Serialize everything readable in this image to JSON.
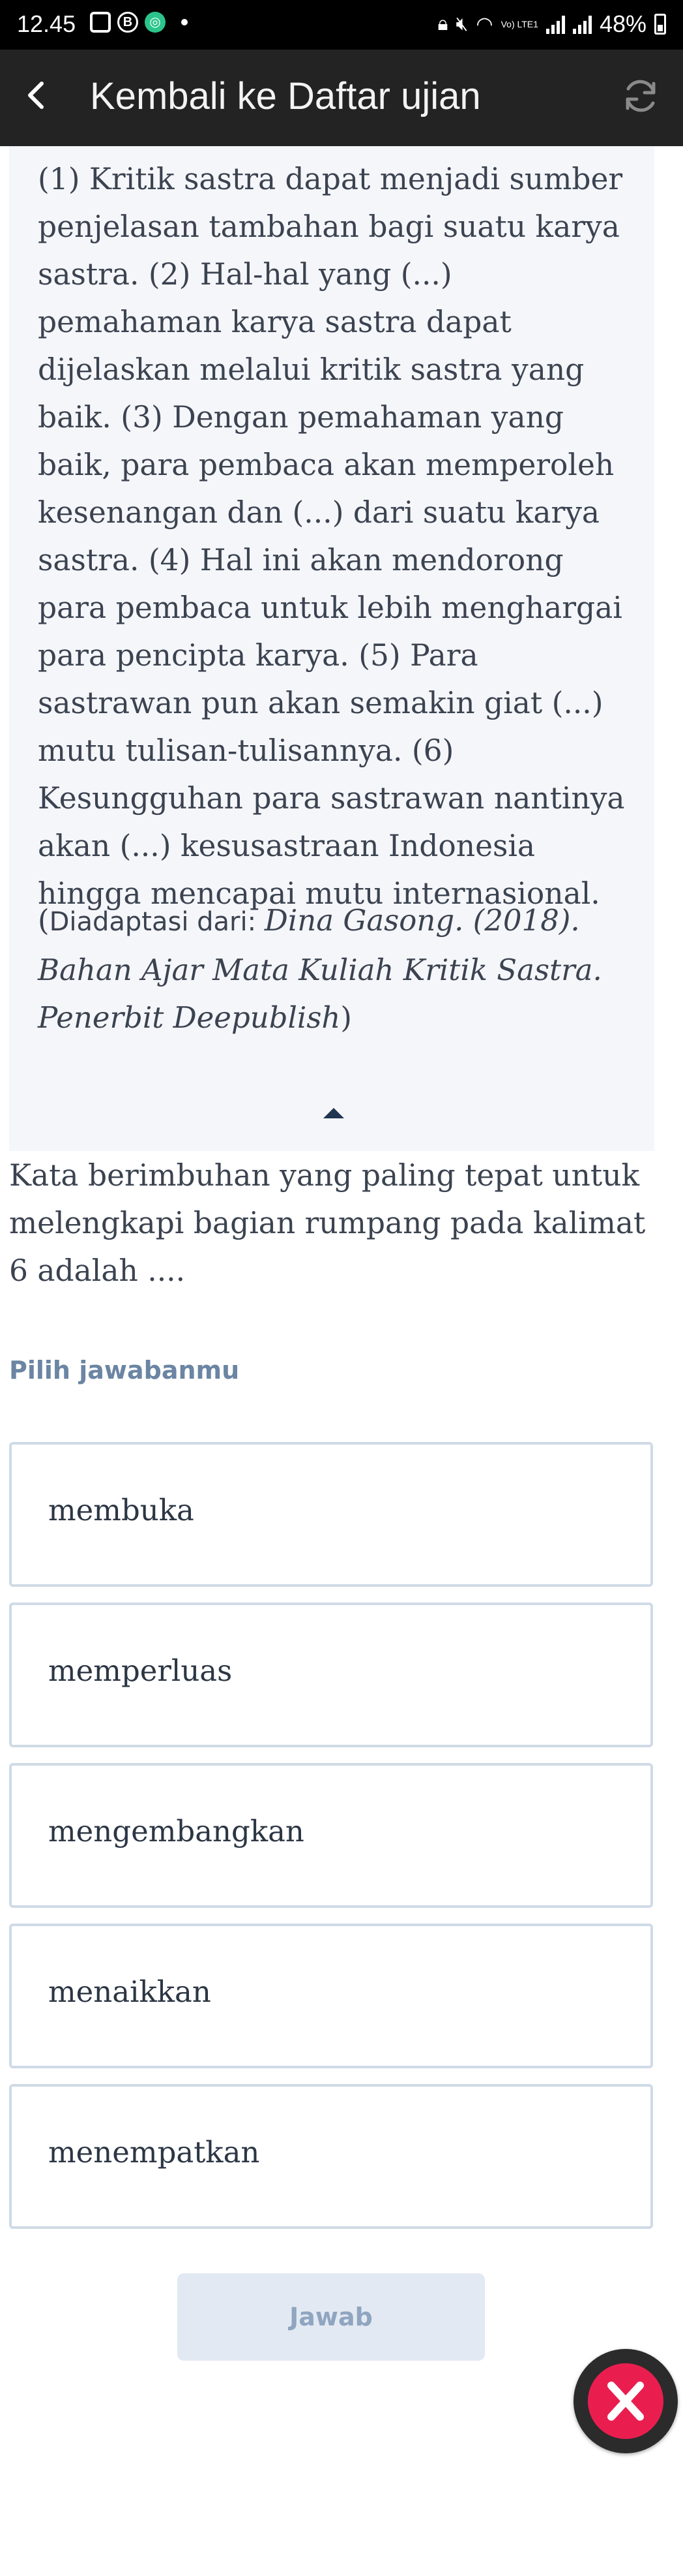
{
  "status_bar": {
    "time": "12.45",
    "network_label": "Vo) LTE1",
    "battery": "48%"
  },
  "header": {
    "title": "Kembali ke Daftar ujian",
    "back_icon": "chevron-left-icon",
    "refresh_icon": "refresh-icon"
  },
  "passage": {
    "text": "(1) Kritik sastra dapat menjadi sumber penjelasan tambahan bagi suatu karya sastra. (2) Hal-hal yang (...) pemahaman karya sastra dapat dijelaskan melalui kritik sastra yang baik. (3) Dengan pemahaman yang baik, para pembaca akan memperoleh kesenangan dan (...) dari suatu karya sastra. (4) Hal ini akan mendorong para pembaca untuk lebih menghargai para pencipta karya. (5) Para sastrawan pun akan semakin giat (...) mutu tulisan-tulisannya. (6) Kesungguhan para sastrawan nantinya akan (...) kesusastraan Indonesia hingga mencapai mutu internasional.",
    "source_open": "(",
    "source_prefix": "Diadaptasi dari: ",
    "source_italic": "Dina Gasong. (2018). Bahan Ajar Mata Kuliah Kritik Sastra. Penerbit Deepublish",
    "source_close": ")"
  },
  "question": {
    "text": "Kata berimbuhan yang paling tepat untuk melengkapi bagian rumpang pada kalimat 6 adalah ....",
    "prompt": "Pilih jawabanmu"
  },
  "options": [
    {
      "label": "membuka"
    },
    {
      "label": "memperluas"
    },
    {
      "label": "mengembangkan"
    },
    {
      "label": "menaikkan"
    },
    {
      "label": "menempatkan"
    }
  ],
  "submit_label": "Jawab",
  "colors": {
    "header_bg": "#232323",
    "passage_bg": "#f5f6fa",
    "option_border": "#cfdbe6",
    "prompt": "#6b85a3",
    "submit_bg": "#e3e9f2",
    "float_accent": "#e91e4f"
  }
}
